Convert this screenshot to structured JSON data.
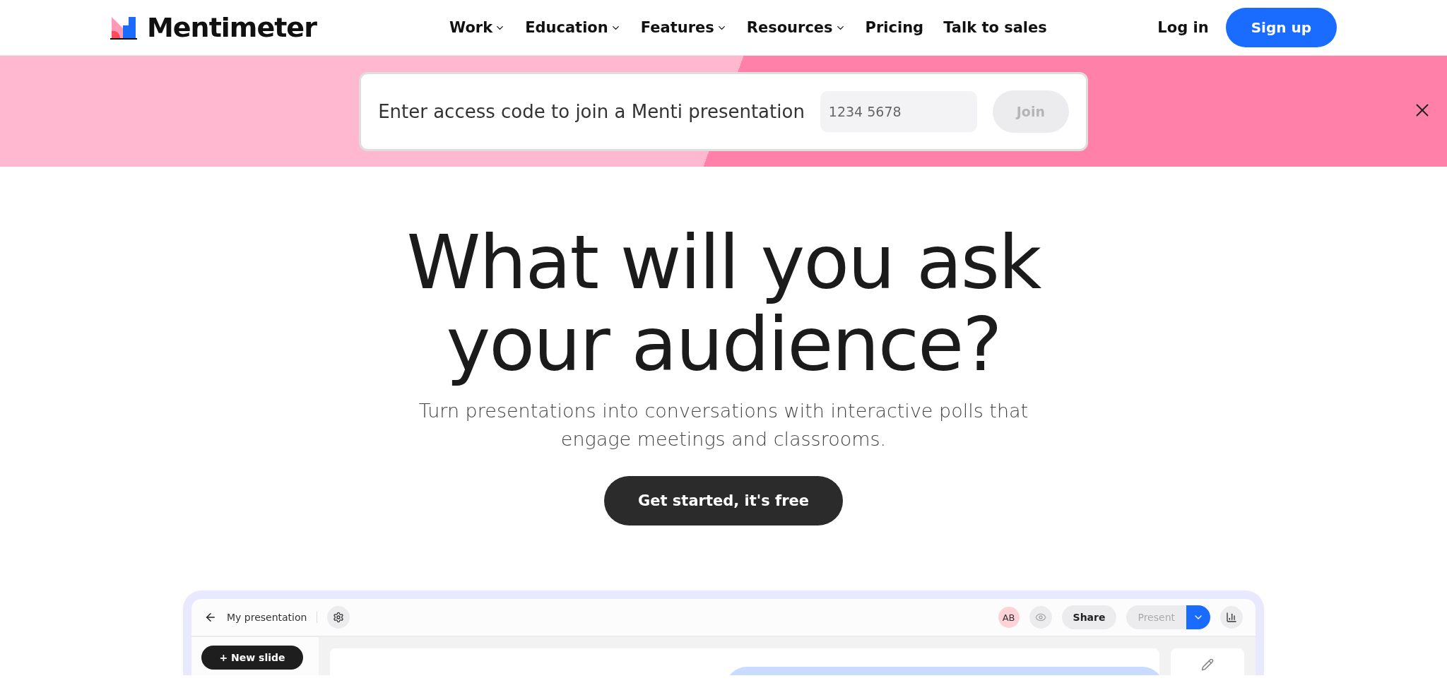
{
  "header": {
    "brand": "Mentimeter",
    "nav": [
      {
        "label": "Work",
        "dropdown": true
      },
      {
        "label": "Education",
        "dropdown": true
      },
      {
        "label": "Features",
        "dropdown": true
      },
      {
        "label": "Resources",
        "dropdown": true
      },
      {
        "label": "Pricing",
        "dropdown": false
      },
      {
        "label": "Talk to sales",
        "dropdown": false
      }
    ],
    "login": "Log in",
    "signup": "Sign up"
  },
  "banner": {
    "prompt": "Enter access code to join a Menti presentation",
    "placeholder": "1234 5678",
    "join": {
      "label": "Join",
      "disabled": true
    }
  },
  "hero": {
    "title": "What will you ask your audience?",
    "subtitle": "Turn presentations into conversations with interactive polls that engage meetings and classrooms.",
    "cta": "Get started, it's free"
  },
  "preview": {
    "title": "My presentation",
    "avatar": "AB",
    "share": "Share",
    "present": {
      "label": "Present",
      "disabled": true
    },
    "new_slide": "+ New slide"
  }
}
